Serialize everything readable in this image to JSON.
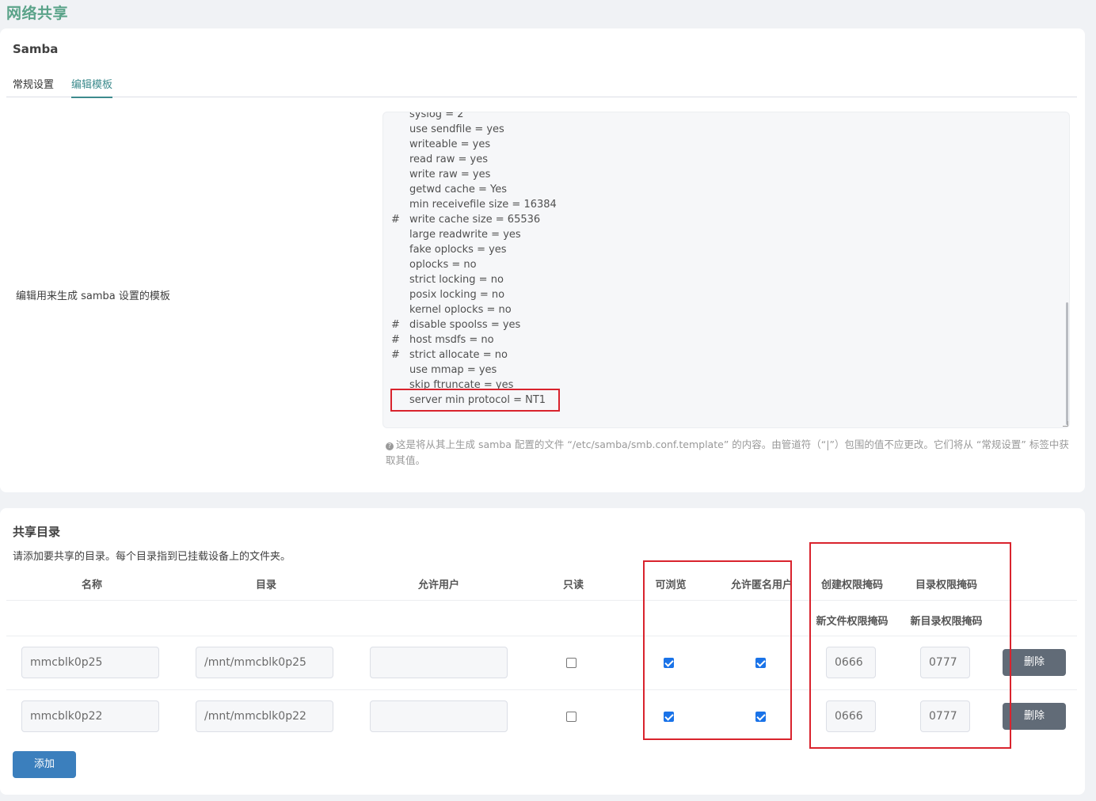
{
  "page": {
    "title": "网络共享"
  },
  "samba": {
    "title": "Samba",
    "tabs": [
      {
        "label": "常规设置",
        "active": false
      },
      {
        "label": "编辑模板",
        "active": true
      }
    ],
    "template_label": "编辑用来生成 samba 设置的模板",
    "template_lines": [
      {
        "hash": "",
        "text": "syslog = 2"
      },
      {
        "hash": "",
        "text": "use sendfile = yes"
      },
      {
        "hash": "",
        "text": "writeable = yes"
      },
      {
        "hash": "",
        "text": "read raw = yes"
      },
      {
        "hash": "",
        "text": "write raw = yes"
      },
      {
        "hash": "",
        "text": "getwd cache = Yes"
      },
      {
        "hash": "",
        "text": "min receivefile size = 16384"
      },
      {
        "hash": "#",
        "text": "write cache size = 65536"
      },
      {
        "hash": "",
        "text": "large readwrite = yes"
      },
      {
        "hash": "",
        "text": "fake oplocks = yes"
      },
      {
        "hash": "",
        "text": "oplocks = no"
      },
      {
        "hash": "",
        "text": "strict locking = no"
      },
      {
        "hash": "",
        "text": "posix locking = no"
      },
      {
        "hash": "",
        "text": "kernel oplocks = no"
      },
      {
        "hash": "#",
        "text": "disable spoolss = yes"
      },
      {
        "hash": "#",
        "text": "host msdfs = no"
      },
      {
        "hash": "#",
        "text": "strict allocate = no"
      },
      {
        "hash": "",
        "text": "use mmap = yes"
      },
      {
        "hash": "",
        "text": "skip ftruncate = yes"
      },
      {
        "hash": "",
        "text": "server min protocol = NT1"
      }
    ],
    "help_icon": "info-icon",
    "help_text": "这是将从其上生成 samba 配置的文件 “/etc/samba/smb.conf.template” 的内容。由管道符（“|”）包围的值不应更改。它们将从 “常规设置” 标签中获取其值。"
  },
  "shares": {
    "title": "共享目录",
    "description": "请添加要共享的目录。每个目录指到已挂载设备上的文件夹。",
    "columns": {
      "name": "名称",
      "dir": "目录",
      "users": "允许用户",
      "readonly": "只读",
      "browseable": "可浏览",
      "guest": "允许匿名用户",
      "create_mask": "创建权限掩码",
      "dir_mask": "目录权限掩码",
      "create_mask_sub": "新文件权限掩码",
      "dir_mask_sub": "新目录权限掩码"
    },
    "rows": [
      {
        "name": "mmcblk0p25",
        "dir": "/mnt/mmcblk0p25",
        "users": "",
        "readonly": false,
        "browseable": true,
        "guest": true,
        "create_mask": "0666",
        "dir_mask": "0777",
        "delete": "删除"
      },
      {
        "name": "mmcblk0p22",
        "dir": "/mnt/mmcblk0p22",
        "users": "",
        "readonly": false,
        "browseable": true,
        "guest": true,
        "create_mask": "0666",
        "dir_mask": "0777",
        "delete": "删除"
      }
    ],
    "add_label": "添加"
  },
  "colors": {
    "accent": "#3d8b8d",
    "title": "#5aa389",
    "add_button": "#3b7fbd",
    "delete_button": "#616b77",
    "highlight": "#d9232d"
  }
}
